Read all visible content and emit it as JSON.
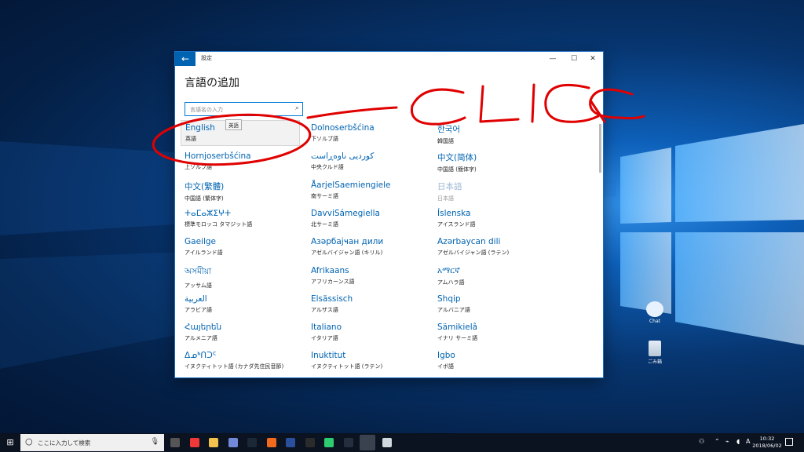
{
  "window": {
    "title": "設定",
    "heading": "言語の追加",
    "search_placeholder": "言語名の入力",
    "controls": {
      "minimize": "—",
      "maximize": "☐",
      "close": "✕"
    },
    "back_icon": "arrow-left-icon"
  },
  "tooltip": "英語",
  "languages": [
    [
      {
        "name": "English",
        "native": "英語"
      },
      {
        "name": "Hornjoserbšćina",
        "native": "上ソルブ語"
      },
      {
        "name": "中文(繁體)",
        "native": "中国語 (繁体字)"
      },
      {
        "name": "ⵜⴰⵎⴰⵣⵉⵖⵜ",
        "native": "標準モロッコ タマジット語"
      },
      {
        "name": "Gaeilge",
        "native": "アイルランド語"
      },
      {
        "name": "অসমীয়া",
        "native": "アッサム語"
      },
      {
        "name": "العربية",
        "native": "アラビア語"
      },
      {
        "name": "Հայերեն",
        "native": "アルメニア語"
      },
      {
        "name": "ᐃᓄᒃᑎᑐᑦ",
        "native": "イヌクティトット語 (カナダ先住民音節)"
      }
    ],
    [
      {
        "name": "Dolnoserbšćina",
        "native": "下ソルブ語"
      },
      {
        "name": "کوردیی ناوەڕاست",
        "native": "中央クルド語"
      },
      {
        "name": "ÅarjelSaemiengiele",
        "native": "南サーミ語"
      },
      {
        "name": "DavviSámegiella",
        "native": "北サーミ語"
      },
      {
        "name": "Азәрбајҹан дили",
        "native": "アゼルバイジャン語 (キリル)"
      },
      {
        "name": "Afrikaans",
        "native": "アフリカーンス語"
      },
      {
        "name": "Elsässisch",
        "native": "アルザス語"
      },
      {
        "name": "Italiano",
        "native": "イタリア語"
      },
      {
        "name": "Inuktitut",
        "native": "イヌクティトット語 (ラテン)"
      }
    ],
    [
      {
        "name": "한국어",
        "native": "韓国語"
      },
      {
        "name": "中文(简体)",
        "native": "中国語 (簡体字)"
      },
      {
        "name": "日本語",
        "native": "日本語",
        "disabled": true
      },
      {
        "name": "Íslenska",
        "native": "アイスランド語"
      },
      {
        "name": "Azərbaycan dili",
        "native": "アゼルバイジャン語 (ラテン)"
      },
      {
        "name": "አማርኛ",
        "native": "アムハラ語"
      },
      {
        "name": "Shqip",
        "native": "アルバニア語"
      },
      {
        "name": "Sämikielâ",
        "native": "イナリ サーミ語"
      },
      {
        "name": "Igbo",
        "native": "イボ語"
      }
    ]
  ],
  "annotation": {
    "text": "CLICK",
    "color": "#e00000"
  },
  "desktop_icons": [
    {
      "label": "Chat",
      "icon": "chat-bubble-icon"
    },
    {
      "label": "ごみ箱",
      "icon": "recycle-bin-icon"
    }
  ],
  "taskbar": {
    "search_text": "ここに入力して検索",
    "start_icon": "windows-logo-icon",
    "apps": [
      "task-view-icon",
      "vivaldi-icon",
      "file-explorer-icon",
      "discord-icon",
      "steam-icon",
      "app-orange-icon",
      "app-blue-icon",
      "epic-games-icon",
      "app-green-icon",
      "amazon-icon",
      "settings-icon",
      "app-globe-icon"
    ],
    "clock_time": "10:32",
    "clock_date": "2018/06/02"
  }
}
